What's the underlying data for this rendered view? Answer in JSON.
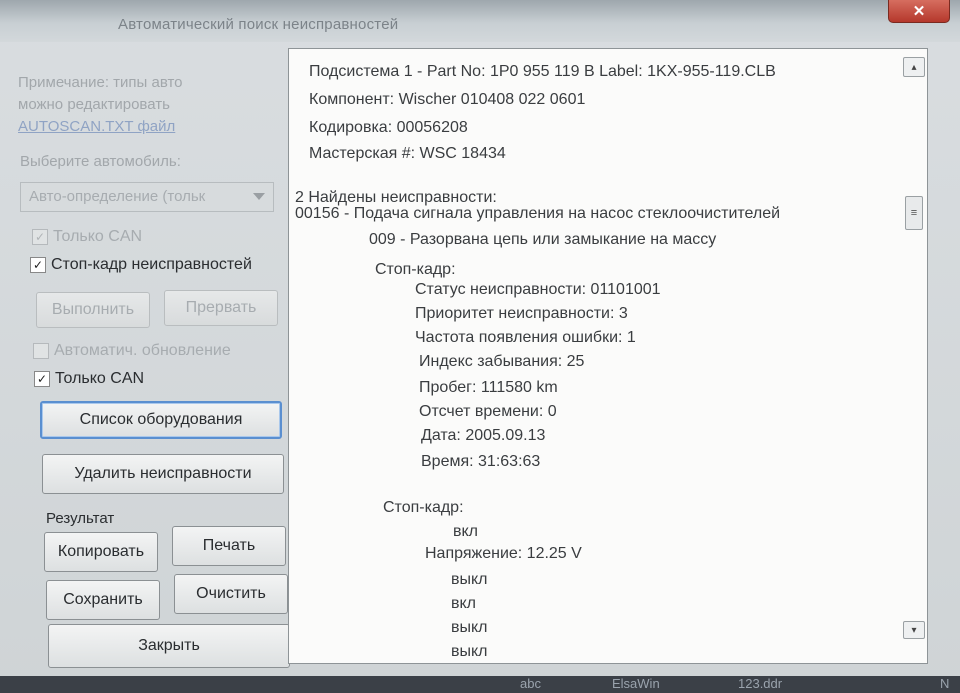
{
  "window": {
    "title": "Автоматический поиск неисправностей",
    "close_glyph": "✕"
  },
  "left": {
    "note_line1": "Примечание: типы авто",
    "note_line2": "можно редактировать",
    "note_link": "AUTOSCAN.TXT файл",
    "select_car_label": "Выберите автомобиль:",
    "car_combo_value": "Авто-определение (тольк",
    "only_can_1": "Только CAN",
    "freeze_frame": "Стоп-кадр неисправностей",
    "run_btn": "Выполнить",
    "abort_btn": "Прервать",
    "auto_update": "Автоматич. обновление",
    "only_can_2": "Только CAN",
    "equipment_list_btn": "Список оборудования",
    "clear_faults_btn": "Удалить неисправности",
    "result_label": "Результат",
    "copy_btn": "Копировать",
    "print_btn": "Печать",
    "save_btn": "Сохранить",
    "clear_btn": "Очистить",
    "close_btn": "Закрыть",
    "check_mark": "✓"
  },
  "log": {
    "lines": [
      "Подсистема 1 - Part No: 1P0 955 119 B  Label: 1KX-955-119.CLB",
      "Компонент: Wischer 010408 022  0601",
      "Кодировка: 00056208",
      "Мастерская #: WSC 18434",
      "2 Найдены неисправности:",
      "00156 - Подача сигнала управления на насос стеклоочистителей",
      "009 - Разорвана цепь или замыкание на массу",
      "Стоп-кадр:",
      "Статус неисправности: 01101001",
      "Приоритет неисправности: 3",
      "Частота появления ошибки: 1",
      "Индекс забывания: 25",
      "Пробег: 111580 km",
      "Отсчет времени: 0",
      "Дата: 2005.09.13",
      "Время: 31:63:63",
      "Стоп-кадр:",
      "вкл",
      "Напряжение: 12.25 V",
      "выкл",
      "вкл",
      "выкл",
      "выкл"
    ],
    "scroll_thumb_glyph": "≡",
    "scroll_down_glyph": "▾"
  },
  "taskbar": {
    "items": [
      "abc",
      "ElsaWin",
      "123.ddr",
      "N"
    ]
  }
}
